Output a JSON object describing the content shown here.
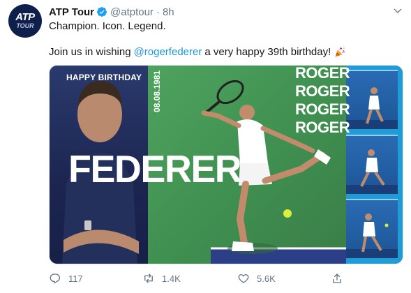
{
  "tweet": {
    "display_name": "ATP Tour",
    "handle": "@atptour",
    "separator": "·",
    "time": "8h",
    "line1": "Champion. Icon. Legend.",
    "line2_before": "Join us in wishing",
    "mention": "@rogerfederer",
    "line2_after": "a very happy 39th birthday!",
    "avatar_top": "ATP",
    "avatar_bottom": "TOUR"
  },
  "media": {
    "happy_birthday": "HAPPY BIRTHDAY",
    "date": "08.08.1981",
    "surname": "FEDERER",
    "roger_1": "ROGER",
    "roger_2": "ROGER",
    "roger_3": "ROGER",
    "roger_4": "ROGER"
  },
  "actions": {
    "replies": "117",
    "retweets": "1.4K",
    "likes": "5.6K"
  },
  "colors": {
    "link": "#1b95e0",
    "muted": "#657786",
    "verified": "#1da1f2",
    "media_green": "#3f8f50",
    "media_navy": "#1c2550",
    "media_blue": "#1f9bd8"
  },
  "icons": [
    "atp-tour-logo",
    "verified-badge-icon",
    "chevron-down-icon",
    "party-popper-icon",
    "reply-icon",
    "retweet-icon",
    "like-icon",
    "share-icon"
  ]
}
